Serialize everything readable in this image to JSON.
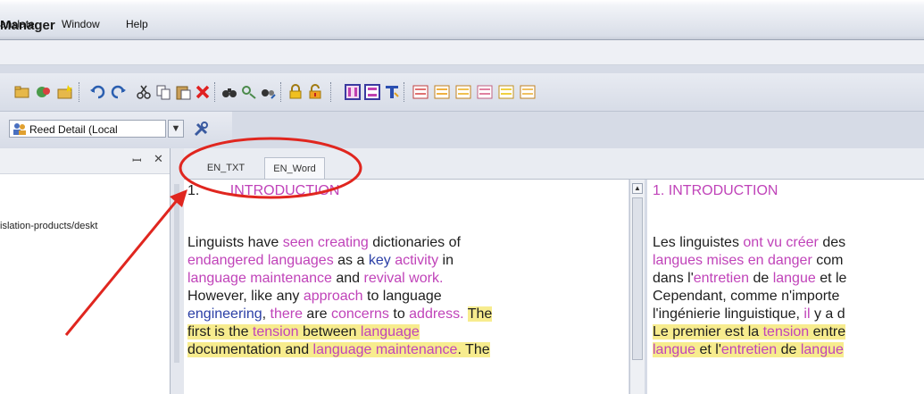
{
  "window": {
    "title": "Manager"
  },
  "menubar": {
    "items": [
      "anslate",
      "Window",
      "Help"
    ]
  },
  "toolbar2": {
    "resource_value": "Reed Detail (Local"
  },
  "left_panel": {
    "pin_glyph": "ꟷ",
    "close_glyph": "✕",
    "path_text": "islation-products/deskt"
  },
  "tabs": [
    "EN_TXT",
    "EN_Word"
  ],
  "doc_left": {
    "heading_number": "1.",
    "heading_text": "INTRODUCTION",
    "l1": {
      "a": "Linguists have ",
      "b": "seen creating",
      "c": " dictionaries of"
    },
    "l2": {
      "a": "endangered languages",
      "b": " as a ",
      "c": "key",
      "d": " ",
      "e": "activity",
      "f": " in"
    },
    "l3": {
      "a": "language maintenance",
      "b": " and ",
      "c": "revival work."
    },
    "l4": {
      "a": "However, like any ",
      "b": "approach",
      "c": " to language"
    },
    "l5": {
      "a": "engineering",
      "b": ", ",
      "c": "there",
      "d": " are ",
      "e": "concerns",
      "f": " to ",
      "g": "address.",
      "h": " ",
      "i": "The"
    },
    "l6": {
      "a": "first is the ",
      "b": "tension",
      "c": " between ",
      "d": "language"
    },
    "l7": {
      "a": "documentation and ",
      "b": "language maintenance",
      "c": ". The"
    }
  },
  "doc_right": {
    "heading": "1. INTRODUCTION",
    "l1": {
      "a": "Les linguistes ",
      "b": "ont vu créer",
      "c": " des"
    },
    "l2": {
      "a": "langues mises en danger",
      "b": " com"
    },
    "l3": {
      "a": "dans l'",
      "b": "entretien",
      "c": " de ",
      "d": "langue",
      "e": " et le"
    },
    "l4": {
      "a": "Cependant, comme n'importe"
    },
    "l5": {
      "a": "l'ingénierie linguistique, ",
      "b": "il",
      "c": " y a d"
    },
    "l6": {
      "a": "Le premier est la ",
      "b": "tension",
      "c": " entre"
    },
    "l7": {
      "a": "langue",
      "b": " et l'",
      "c": "entretien",
      "d": " de ",
      "e": "langue"
    }
  },
  "colors": {
    "accent_pink": "#c043b9",
    "accent_blue": "#2b3fa6",
    "highlight": "#f7ec8e",
    "annotation_red": "#e0261f"
  }
}
